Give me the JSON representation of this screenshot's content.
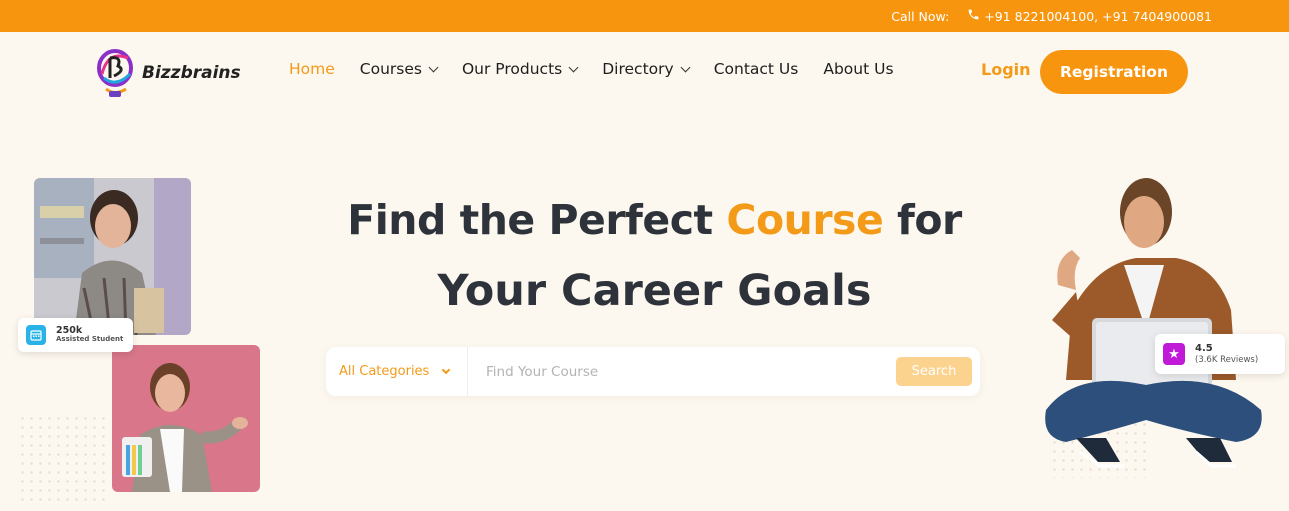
{
  "topbar": {
    "call_label": "Call Now:",
    "phones": "+91 8221004100, +91 7404900081",
    "icon": "phone-icon"
  },
  "brand": {
    "name": "Bizzbrains",
    "logo_icon": "bizzbrains-logo-icon"
  },
  "nav": {
    "items": [
      {
        "label": "Home",
        "active": true,
        "dropdown": false
      },
      {
        "label": "Courses",
        "active": false,
        "dropdown": true
      },
      {
        "label": "Our Products",
        "active": false,
        "dropdown": true
      },
      {
        "label": "Directory",
        "active": false,
        "dropdown": true
      },
      {
        "label": "Contact Us",
        "active": false,
        "dropdown": false
      },
      {
        "label": "About Us",
        "active": false,
        "dropdown": false
      }
    ],
    "login_label": "Login",
    "register_label": "Registration"
  },
  "hero": {
    "line1_pre": "Find the Perfect ",
    "line1_accent": "Course",
    "line1_post": " for",
    "line2": "Your Career Goals"
  },
  "search": {
    "category_label": "All Categories",
    "placeholder": "Find Your Course",
    "button_label": "Search"
  },
  "stats": {
    "students_value": "250k",
    "students_label": "Assisted Student",
    "icon": "calendar-icon"
  },
  "rating": {
    "value": "4.5",
    "reviews": "(3.6K Reviews)",
    "icon": "star-icon"
  },
  "colors": {
    "accent": "#f7950f",
    "accent_text": "#f39a18",
    "background": "#fdf8ef",
    "heading": "#2e333b"
  }
}
